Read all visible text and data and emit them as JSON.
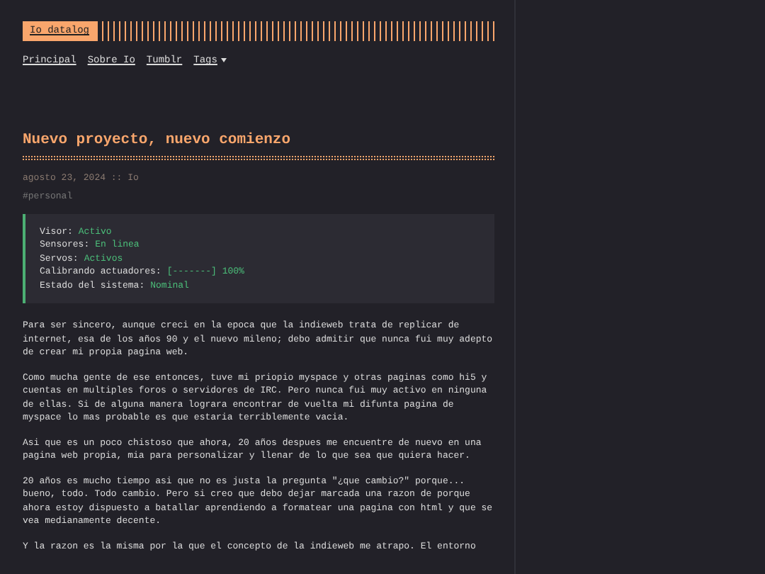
{
  "site": {
    "logo": "Io datalog"
  },
  "nav": [
    {
      "label": "Principal",
      "kind": "link"
    },
    {
      "label": "Sobre Io",
      "kind": "link"
    },
    {
      "label": "Tumblr",
      "kind": "link"
    },
    {
      "label": "Tags",
      "kind": "dropdown"
    }
  ],
  "post": {
    "title": "Nuevo proyecto, nuevo comienzo",
    "meta": "agosto 23, 2024 :: Io",
    "tag": "#personal",
    "status": [
      {
        "label": "Visor:",
        "value": "Activo"
      },
      {
        "label": "Sensores:",
        "value": "En linea"
      },
      {
        "label": "Servos:",
        "value": "Activos"
      },
      {
        "label": "Calibrando actuadores:",
        "value": "[-------] 100%"
      },
      {
        "label": "Estado del sistema:",
        "value": "Nominal"
      }
    ],
    "paragraphs": [
      "Para ser sincero, aunque creci en la epoca que la indieweb trata de replicar de internet, esa de los años 90 y el nuevo mileno; debo admitir que nunca fui muy adepto de crear mi propia pagina web.",
      "Como mucha gente de ese entonces, tuve mi priopio myspace y otras paginas como hi5 y cuentas en multiples foros o servidores de IRC. Pero nunca fui muy activo en ninguna de ellas. Si de alguna manera lograra encontrar de vuelta mi difunta pagina de myspace lo mas probable es que estaria terriblemente vacia.",
      "Asi que es un poco chistoso que ahora, 20 años despues me encuentre de nuevo en una pagina web propia, mia para personalizar y llenar de lo que sea que quiera hacer.",
      "20 años es mucho tiempo asi que no es justa la pregunta \"¿que cambio?\" porque... bueno, todo. Todo cambio. Pero si creo que debo dejar marcada una razon de porque ahora estoy dispuesto a batallar aprendiendo a formatear una pagina con html y que se vea medianamente decente.",
      "Y la razon es la misma por la que el concepto de la indieweb me atrapo. El entorno"
    ]
  }
}
